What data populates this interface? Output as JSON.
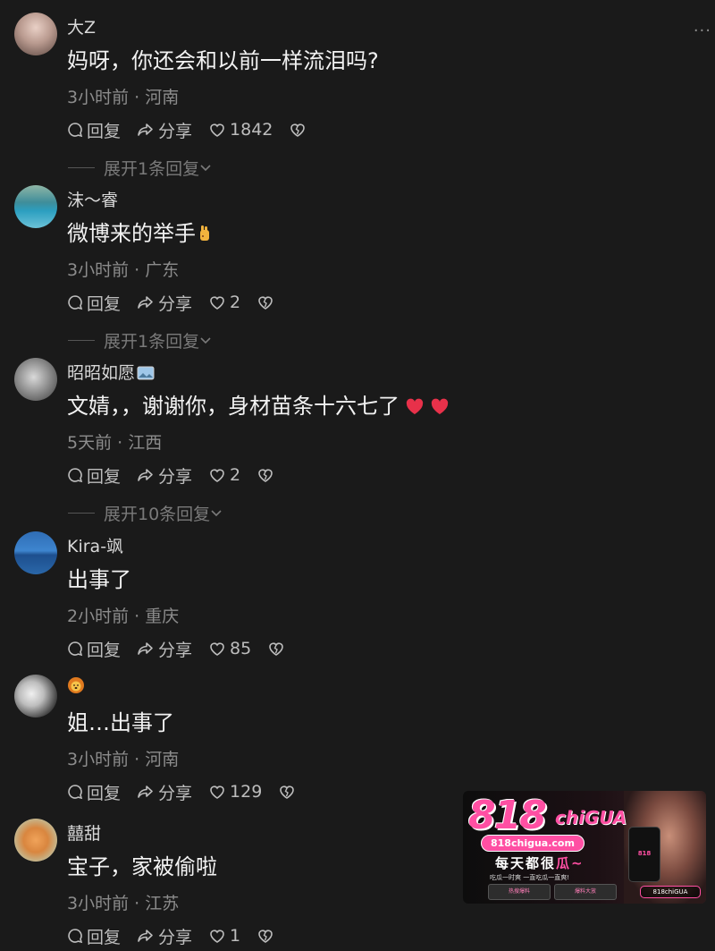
{
  "comments": [
    {
      "username": "大Z",
      "content": "妈呀，你还会和以前一样流泪吗?",
      "meta": "3小时前 · 河南",
      "reply_label": "回复",
      "share_label": "分享",
      "likes": "1842",
      "expand": "展开1条回复"
    },
    {
      "username": "沫～睿",
      "content": "微博来的举手",
      "meta": "3小时前 · 广东",
      "reply_label": "回复",
      "share_label": "分享",
      "likes": "2",
      "expand": "展开1条回复"
    },
    {
      "username": "昭昭如愿",
      "content": "文婧，，谢谢你，身材苗条十六七了",
      "meta": "5天前 · 江西",
      "reply_label": "回复",
      "share_label": "分享",
      "likes": "2",
      "expand": "展开10条回复"
    },
    {
      "username": "Kira-飒",
      "content": "出事了",
      "meta": "2小时前 · 重庆",
      "reply_label": "回复",
      "share_label": "分享",
      "likes": "85"
    },
    {
      "username": "",
      "content": "姐…出事了",
      "meta": "3小时前 · 河南",
      "reply_label": "回复",
      "share_label": "分享",
      "likes": "129"
    },
    {
      "username": "囍甜",
      "content": "宝子，家被偷啦",
      "meta": "3小时前 · 江苏",
      "reply_label": "回复",
      "share_label": "分享",
      "likes": "1"
    }
  ],
  "more_label": "···",
  "ad": {
    "logo": "818",
    "logo_sub": "chiGUA",
    "url": "818chigua.com",
    "slogan_pre": "每天都很",
    "slogan_pink": "瓜~",
    "tagline": "吃瓜一时爽 一直吃瓜一直爽!",
    "btn1": "热搜爆料",
    "btn2": "爆料大放",
    "phone_text": "818",
    "badge": "818chiGUA"
  },
  "colors": {
    "background": "#1a1a1a",
    "text": "#f2f2f2",
    "meta": "#8c8c8c",
    "accent_pink": "#ff4fa3",
    "heart_red": "#e8314a"
  },
  "icons": [
    "comment-icon",
    "share-icon",
    "like-icon",
    "dislike-icon",
    "chevron-down-icon",
    "raised-hand-emoji",
    "heart-emoji",
    "photo-emoji",
    "lion-emoji",
    "more-icon"
  ]
}
